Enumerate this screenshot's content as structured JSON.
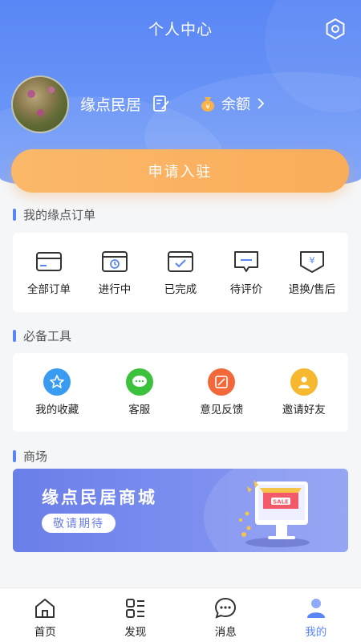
{
  "header": {
    "title": "个人中心"
  },
  "profile": {
    "username": "缘点民居",
    "balance_label": "余额"
  },
  "apply_button": "申请入驻",
  "orders_section": {
    "title": "我的缘点订单",
    "items": [
      {
        "label": "全部订单",
        "icon": "card-icon"
      },
      {
        "label": "进行中",
        "icon": "in-progress-icon"
      },
      {
        "label": "已完成",
        "icon": "completed-icon"
      },
      {
        "label": "待评价",
        "icon": "comment-icon"
      },
      {
        "label": "退换/售后",
        "icon": "refund-icon"
      }
    ]
  },
  "tools_section": {
    "title": "必备工具",
    "items": [
      {
        "label": "我的收藏",
        "icon": "star-icon",
        "color": "#3a9cf0"
      },
      {
        "label": "客服",
        "icon": "chat-icon",
        "color": "#3cc13c"
      },
      {
        "label": "意见反馈",
        "icon": "feedback-icon",
        "color": "#f2683a"
      },
      {
        "label": "邀请好友",
        "icon": "invite-icon",
        "color": "#f5b82e"
      }
    ]
  },
  "mall_section": {
    "title": "商场",
    "banner_title": "缘点民居商城",
    "banner_tag": "敬请期待"
  },
  "tabbar": {
    "items": [
      {
        "label": "首页",
        "icon": "home-icon"
      },
      {
        "label": "发现",
        "icon": "discover-icon"
      },
      {
        "label": "消息",
        "icon": "message-icon"
      },
      {
        "label": "我的",
        "icon": "profile-icon",
        "active": true
      }
    ]
  },
  "colors": {
    "primary": "#5a86f5",
    "accent_orange": "#f9ad5b"
  }
}
